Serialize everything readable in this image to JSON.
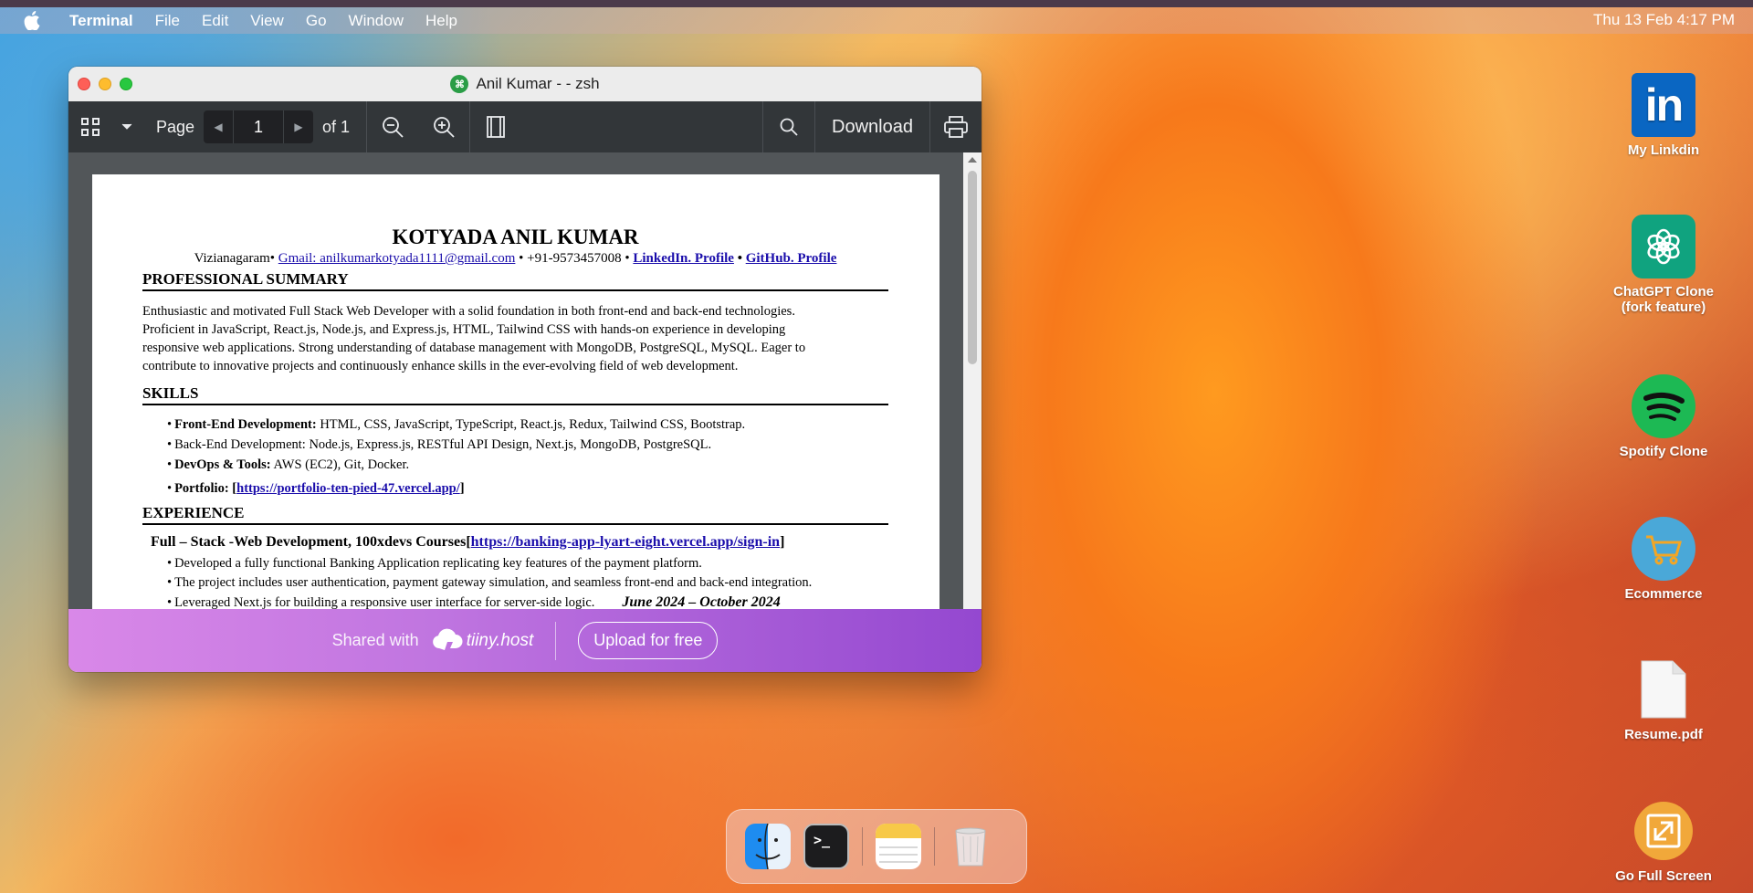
{
  "menubar": {
    "app_name": "Terminal",
    "items": [
      "File",
      "Edit",
      "View",
      "Go",
      "Window",
      "Help"
    ],
    "clock": "Thu 13 Feb 4:17 PM"
  },
  "window": {
    "title": "Anil Kumar - - zsh"
  },
  "pdf_toolbar": {
    "page_label": "Page",
    "page_number": "1",
    "page_total": "of 1",
    "download_label": "Download"
  },
  "resume": {
    "name": "KOTYADA ANIL KUMAR",
    "location": "Vizianagaram•",
    "email": "Gmail: anilkumarkotyada1111@gmail.com",
    "phone": "• +91-9573457008 •",
    "linkedin": "LinkedIn. Profile",
    "dot": "•",
    "github": "GitHub. Profile",
    "summary_heading": "PROFESSIONAL SUMMARY",
    "summary_lines": [
      "Enthusiastic and motivated Full Stack Web Developer with a solid foundation in both front-end and back-end technologies.",
      "Proficient in JavaScript, React.js, Node.js, and Express.js, HTML, Tailwind CSS with hands-on experience in developing",
      "responsive web applications. Strong understanding of database management with MongoDB, PostgreSQL, MySQL. Eager to",
      "contribute to innovative projects and continuously enhance skills in the ever-evolving field of web development."
    ],
    "skills_heading": "SKILLS",
    "skills": [
      {
        "label": "Front-End Development:",
        "text": " HTML, CSS, JavaScript, TypeScript, React.js, Redux, Tailwind CSS, Bootstrap."
      },
      {
        "label": "Back-End Development:",
        "text": " Node.js, Express.js, RESTful API Design, Next.js, MongoDB, PostgreSQL."
      },
      {
        "label": "DevOps & Tools:",
        "text": " AWS (EC2), Git, Docker."
      }
    ],
    "portfolio_label": "Portfolio: [",
    "portfolio_link": "https://portfolio-ten-pied-47.vercel.app/",
    "portfolio_end": "]",
    "experience_heading": "EXPERIENCE",
    "exp_title": "Full – Stack -Web Development, 100xdevs  Courses[",
    "exp_link": "https://banking-app-lyart-eight.vercel.app/sign-in",
    "exp_end": "]",
    "exp_bullets": [
      "Developed a fully functional Banking Application replicating key features of the payment platform.",
      "The project includes user authentication, payment gateway simulation, and seamless front-end and back-end integration.",
      "Leveraged Next.js for building a responsive user interface for server-side logic."
    ],
    "exp_dates": "June 2024 – October 2024"
  },
  "banner": {
    "shared_with": "Shared with",
    "brand": "tiiny.host",
    "upload": "Upload for free"
  },
  "desktop_icons": [
    {
      "label": "My Linkdin",
      "icon": "linkedin-icon"
    },
    {
      "label": "ChatGPT Clone (fork feature)",
      "icon": "chatgpt-icon"
    },
    {
      "label": "Spotify Clone",
      "icon": "spotify-icon"
    },
    {
      "label": "Ecommerce",
      "icon": "cart-icon"
    },
    {
      "label": "Resume.pdf",
      "icon": "document-icon"
    },
    {
      "label": "Go Full Screen",
      "icon": "fullscreen-icon"
    }
  ],
  "dock": {
    "apps": [
      "finder-icon",
      "terminal-icon",
      "notes-icon",
      "trash-icon"
    ]
  },
  "colors": {
    "linkedin": "#0a66c2",
    "chatgpt": "#10a37f",
    "spotify": "#1db954",
    "link": "#1a0dab"
  }
}
